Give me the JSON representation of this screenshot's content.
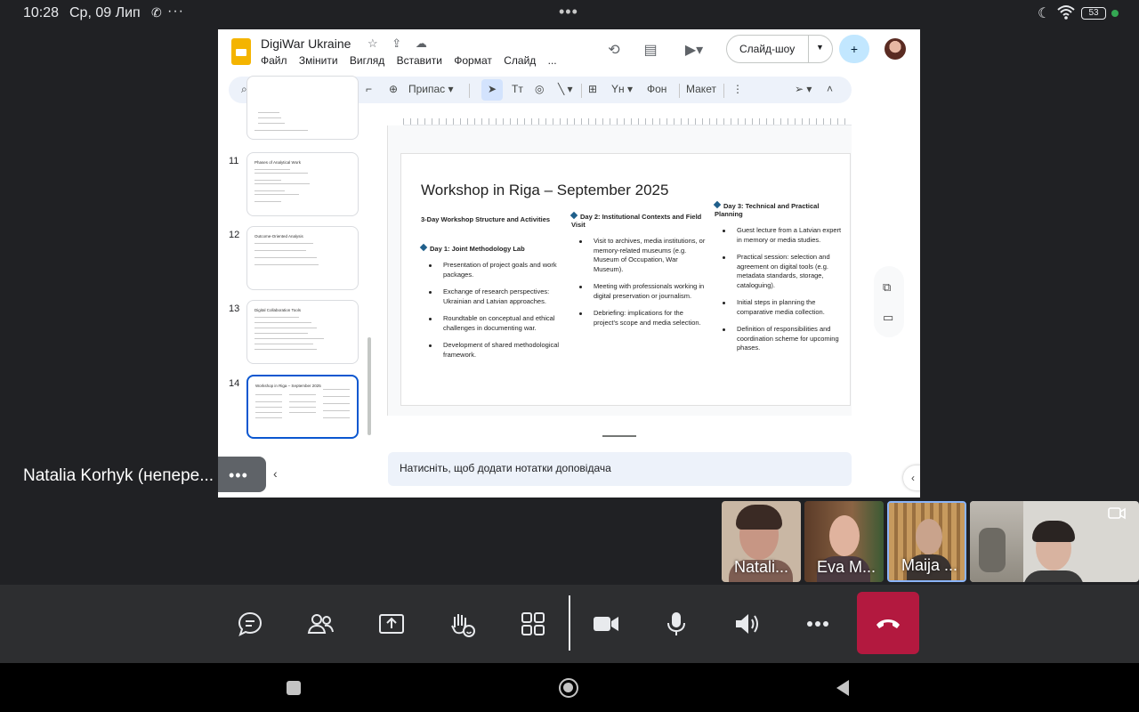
{
  "status_bar": {
    "time": "10:28",
    "date": "Ср, 09 Лип",
    "battery": "53"
  },
  "slides_app": {
    "doc_title": "DigiWar Ukraine",
    "menu": [
      "Файл",
      "Змінити",
      "Вигляд",
      "Вставити",
      "Формат",
      "Слайд",
      "..."
    ],
    "slideshow_label": "Слайд-шоу",
    "toolbar": {
      "zoom_label": "Припас",
      "text_format": "Тт",
      "background": "Фон",
      "layout": "Макет"
    },
    "notes_placeholder": "Натисніть, щоб додати нотатки доповідача",
    "filmstrip": [
      {
        "num": "11",
        "title": "Phases of Analytical Work"
      },
      {
        "num": "12",
        "title": "Outcome-Oriented Analysis"
      },
      {
        "num": "13",
        "title": "Digital Collaboration Tools"
      },
      {
        "num": "14",
        "title": "Workshop in Riga – September 2025",
        "active": true
      }
    ],
    "slide": {
      "title": "Workshop in Riga – September 2025",
      "subtitle": "3-Day Workshop Structure and Activities",
      "day1": {
        "heading": "Day 1: Joint Methodology Lab",
        "items": [
          "Presentation of project goals and work packages.",
          "Exchange of research perspectives: Ukrainian and Latvian approaches.",
          "Roundtable on conceptual and ethical challenges in documenting war.",
          "Development of shared methodological framework."
        ]
      },
      "day2": {
        "heading": "Day 2: Institutional Contexts and Field Visit",
        "items": [
          "Visit to archives, media institutions, or memory-related museums (e.g. Museum of Occupation, War Museum).",
          "Meeting with professionals working in digital preservation or journalism.",
          "Debriefing: implications for the project's scope and media selection."
        ]
      },
      "day3": {
        "heading": "Day 3: Technical and Practical Planning",
        "items": [
          "Guest lecture from a Latvian expert in memory or media studies.",
          "Practical session: selection and agreement on digital tools (e.g. metadata standards, storage, cataloguing).",
          "Initial steps in planning the comparative media collection.",
          "Definition of responsibilities and coordination scheme for upcoming phases."
        ]
      }
    }
  },
  "presenter_label": "Natalia Korhyk (непере...",
  "participants": [
    {
      "name": "Natali..."
    },
    {
      "name": "Eva M..."
    },
    {
      "name": "Maija ..."
    }
  ]
}
